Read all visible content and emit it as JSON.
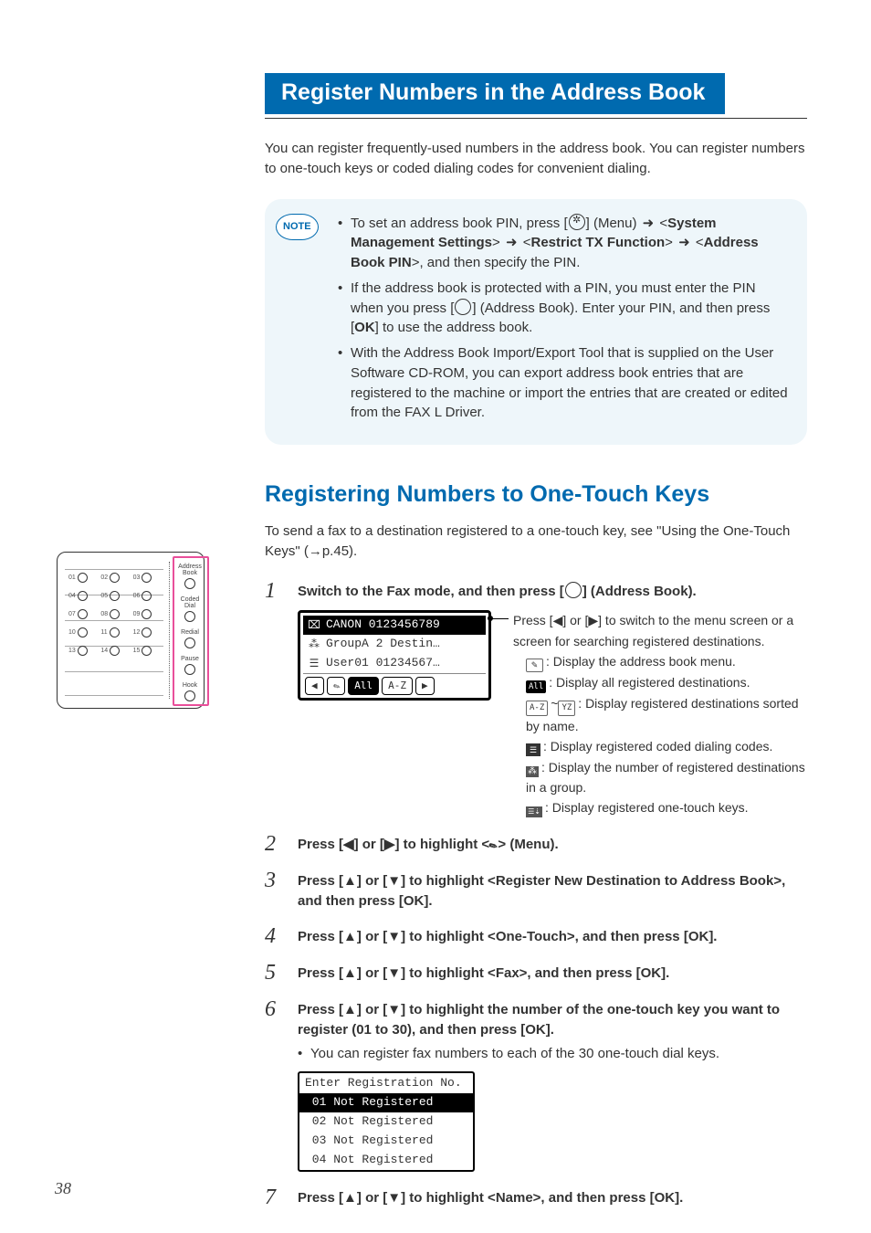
{
  "title": "Register Numbers in the Address Book",
  "intro": "You can register frequently-used numbers in the address book. You can register numbers to one-touch keys or coded dialing codes for convenient dialing.",
  "note_label": "NOTE",
  "note_items": [
    {
      "prefix": "To set an address book PIN, press [",
      "icon": "menu-gear",
      "mid1": "] (Menu) ",
      "arrow1": "➜",
      "seg1": " <",
      "b1": "System Management Settings",
      "seg2": "> ",
      "arrow2": "➜",
      "seg3": " <",
      "b2": "Restrict TX Function",
      "seg4": "> ",
      "arrow3": "➜",
      "seg5": " <",
      "b3": "Address Book PIN",
      "suffix": ">, and then specify the PIN."
    },
    {
      "prefix": "If the address book is protected with a PIN, you must enter the PIN when you press [",
      "icon": "circle",
      "mid1": "] (Address Book). Enter your PIN, and then press [",
      "b1": "OK",
      "suffix": "] to use the address book."
    },
    {
      "text": "With the Address Book Import/Export Tool that is supplied on the User Software CD-ROM, you can export address book entries that are registered to the machine or import the entries that are created or edited from the FAX L Driver."
    }
  ],
  "section_heading": "Registering Numbers to One-Touch Keys",
  "section_intro_pre": "To send a fax to a destination registered to a one-touch key, see \"Using the One-Touch Keys\" (",
  "section_intro_arrow": "→",
  "section_intro_post": "p.45).",
  "steps": {
    "s1": {
      "num": "1",
      "title_pre": "Switch to the Fax mode, and then press [",
      "title_post": "] (Address Book).",
      "lcd": {
        "r1_icon": "⌧",
        "r1_text": "CANON 0123456789",
        "r2_icon": "⁂",
        "r2_text": "GroupA 2 Destin…",
        "r3_icon": "☰",
        "r3_text": "User01 01234567…",
        "tab_left": "◀",
        "tab_menu": "✎",
        "tab_all": "All",
        "tab_az": "A-Z",
        "tab_right": "▶"
      },
      "legend": {
        "intro_pre": "Press [",
        "intro_l": "◀",
        "intro_mid": "] or [",
        "intro_r": "▶",
        "intro_post": "] to switch to the menu screen or a screen for searching registered destinations.",
        "pencil_icon": "✎",
        "pencil": ": Display the address book menu.",
        "all_icon": "All",
        "all": ": Display all registered destinations.",
        "range_a": "A-Z",
        "range_tilde": "~",
        "range_b": "YZ",
        "range": ": Display registered destinations sorted by name.",
        "coded_icon": "☰",
        "coded": ": Display registered coded dialing codes.",
        "group_icon": "⁂",
        "group": ": Display the number of registered destinations in a group.",
        "ot_icon": "☰⇣",
        "ot": ": Display registered one-touch keys."
      }
    },
    "s2": {
      "num": "2",
      "pre": "Press [",
      "l": "◀",
      "mid": "] or [",
      "r": "▶",
      "post_a": "] to highlight <",
      "icon": "✎",
      "post_b": "> (Menu)."
    },
    "s3": {
      "num": "3",
      "pre": "Press [",
      "u": "▲",
      "mid": "] or [",
      "d": "▼",
      "post": "] to highlight <Register New Destination to Address Book>, and then press [OK]."
    },
    "s4": {
      "num": "4",
      "pre": "Press [",
      "u": "▲",
      "mid": "] or [",
      "d": "▼",
      "post": "] to highlight <One-Touch>, and then press [OK]."
    },
    "s5": {
      "num": "5",
      "pre": "Press [",
      "u": "▲",
      "mid": "] or [",
      "d": "▼",
      "post": "] to highlight <Fax>, and then press [OK]."
    },
    "s6": {
      "num": "6",
      "pre": "Press [",
      "u": "▲",
      "mid": "] or [",
      "d": "▼",
      "post": "] to highlight the number of the one-touch key you want to register (01 to 30), and then press [OK].",
      "sub": "You can register fax numbers to each of the 30 one-touch dial keys.",
      "lcd": {
        "title": "Enter Registration No.",
        "rows": [
          " 01 Not Registered",
          " 02 Not Registered",
          " 03 Not Registered",
          " 04 Not Registered"
        ]
      }
    },
    "s7": {
      "num": "7",
      "pre": "Press [",
      "u": "▲",
      "mid": "] or [",
      "d": "▼",
      "post": "] to highlight <Name>, and then press [OK]."
    }
  },
  "panel": {
    "keys": [
      "01",
      "02",
      "03",
      "04",
      "05",
      "06",
      "07",
      "08",
      "09",
      "10",
      "11",
      "12",
      "13",
      "14",
      "15"
    ],
    "side": [
      "Address Book",
      "Coded Dial",
      "Redial",
      "Pause",
      "Hook"
    ]
  },
  "page_number": "38"
}
